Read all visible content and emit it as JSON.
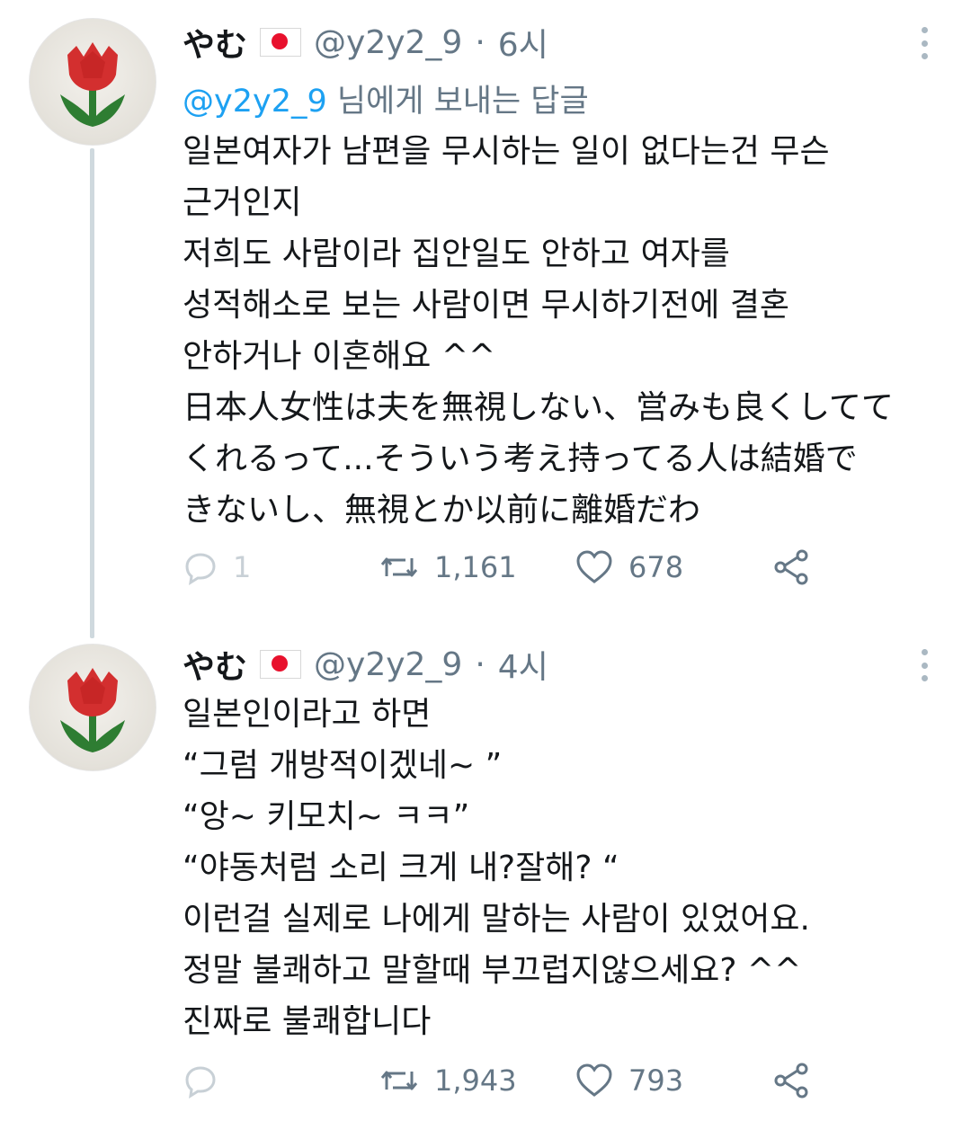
{
  "tweets": [
    {
      "display_name": "やむ",
      "handle": "@y2y2_9",
      "separator": "·",
      "time": "6시",
      "reply_to_mention": "@y2y2_9",
      "reply_to_suffix": " 님에게 보내는 답글",
      "lines": [
        "일본여자가 남편을 무시하는 일이 없다는건 무슨",
        "근거인지",
        "저희도 사람이라 집안일도 안하고 여자를",
        "성적해소로 보는 사람이면 무시하기전에 결혼",
        "안하거나 이혼해요 ^^",
        "日本人女性は夫を無視しない、営みも良くしてて",
        "くれるって...そういう考え持ってる人は結婚で",
        "きないし、無視とか以前に離婚だわ"
      ],
      "reply_count": "1",
      "retweet_count": "1,161",
      "like_count": "678"
    },
    {
      "display_name": "やむ",
      "handle": "@y2y2_9",
      "separator": "·",
      "time": "4시",
      "lines": [
        "일본인이라고 하면",
        "“그럼 개방적이겠네~ ”",
        "“앙~ 키모치~ ㅋㅋ”",
        "“야동처럼 소리 크게 내?잘해?  “",
        "이런걸 실제로 나에게 말하는 사람이 있었어요.",
        "정말 불쾌하고 말할때 부끄럽지않으세요? ^^",
        "진짜로 불쾌합니다"
      ],
      "reply_count": "",
      "retweet_count": "1,943",
      "like_count": "793"
    }
  ],
  "icons": {
    "reply": "reply-icon",
    "retweet": "retweet-icon",
    "like": "heart-icon",
    "share": "share-icon",
    "more": "more-vertical-icon",
    "flag": "japan-flag-icon"
  },
  "colors": {
    "handle_gray": "#657786",
    "mention_blue": "#1da1f2",
    "thread_line": "#cfd9de",
    "flag_red": "#e8112d"
  }
}
